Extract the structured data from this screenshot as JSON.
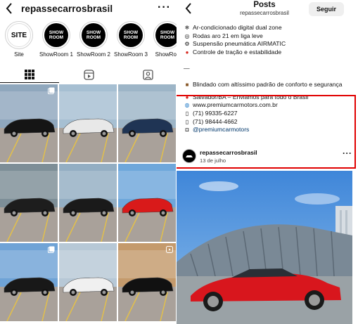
{
  "left_pane": {
    "profile_name": "repassecarrosbrasil",
    "back_icon": "chevron-left-icon",
    "more_icon": "more-horizontal-icon",
    "highlights": [
      {
        "cover": "SITE",
        "label": "Site"
      },
      {
        "cover": "SHOW ROOM",
        "label": "ShowRoom 1"
      },
      {
        "cover": "SHOW ROOM",
        "label": "ShowRoom 2"
      },
      {
        "cover": "SHOW ROOM",
        "label": "ShowRoom 3"
      },
      {
        "cover": "SHOW ROOM",
        "label": "ShowRoo"
      }
    ],
    "tabs": [
      {
        "name": "posts",
        "icon": "grid-icon",
        "active": true
      },
      {
        "name": "reels",
        "icon": "reels-icon",
        "active": false
      },
      {
        "name": "tagged",
        "icon": "tagged-person-icon",
        "active": false
      }
    ],
    "grid_posts": [
      {
        "subject": "black sedan",
        "badge": "carousel-icon",
        "car_color": "#151515",
        "bg": "#8fa7bd"
      },
      {
        "subject": "white SUV",
        "badge": "",
        "car_color": "#e8e8e8",
        "bg": "#a6bfd2"
      },
      {
        "subject": "blue SUV",
        "badge": "",
        "car_color": "#1f3454",
        "bg": "#9db5c7"
      },
      {
        "subject": "black pickup",
        "badge": "",
        "car_color": "#1d1d1d",
        "bg": "#7d8e97"
      },
      {
        "subject": "black coupe SUV",
        "badge": "",
        "car_color": "#1a1a1a",
        "bg": "#93aec3"
      },
      {
        "subject": "red sports car",
        "badge": "",
        "car_color": "#d91a1a",
        "bg": "#6ea7db"
      },
      {
        "subject": "black sedan",
        "badge": "carousel-icon",
        "car_color": "#181818",
        "bg": "#6fa3d6"
      },
      {
        "subject": "white pickup",
        "badge": "",
        "car_color": "#f0f0f0",
        "bg": "#b7c8d6"
      },
      {
        "subject": "black sports car",
        "badge": "reel-icon",
        "car_color": "#111111",
        "bg": "#c49a6c"
      }
    ]
  },
  "right_pane": {
    "header_title": "Posts",
    "header_subtitle": "repassecarrosbrasil",
    "follow_label": "Seguir",
    "caption_lines": [
      {
        "emoji": "snowflake-icon",
        "text": "Ar-condicionado digital dual zone",
        "link": false
      },
      {
        "emoji": "wheel-icon",
        "text": "Rodas aro 21 em liga leve",
        "link": false
      },
      {
        "emoji": "gear-icon",
        "text": "Suspensão pneumática AIRMATIC",
        "link": false
      },
      {
        "emoji": "red-circle-icon",
        "text": "Controle de tração e estabilidade",
        "link": false
      }
    ],
    "separator": "—",
    "caption_line_armor": {
      "emoji": "briefcase-icon",
      "text": "Blindado com altíssimo padrão de conforto e segurança"
    },
    "contact_lines": [
      {
        "emoji": "pin-icon",
        "text": "Salvador/BA – Enviamos para todo o Brasil",
        "link": false
      },
      {
        "emoji": "globe-icon",
        "text": "www.premiumcarmotors.com.br",
        "link": false
      },
      {
        "emoji": "phone-icon",
        "text": "(71) 99335-6227",
        "link": false
      },
      {
        "emoji": "phone-icon",
        "text": "(71) 98444-4662",
        "link": false
      },
      {
        "emoji": "camera-icon",
        "text": "@premiumcarmotors",
        "link": true
      }
    ],
    "poster_name": "repassecarrosbrasil",
    "post_date": "13 de julho",
    "photo_subject": "red sports car in front of glass dome",
    "accent_colors": {
      "highlight_border": "#e00000",
      "link": "#00376b",
      "car": "#d8161d"
    }
  }
}
